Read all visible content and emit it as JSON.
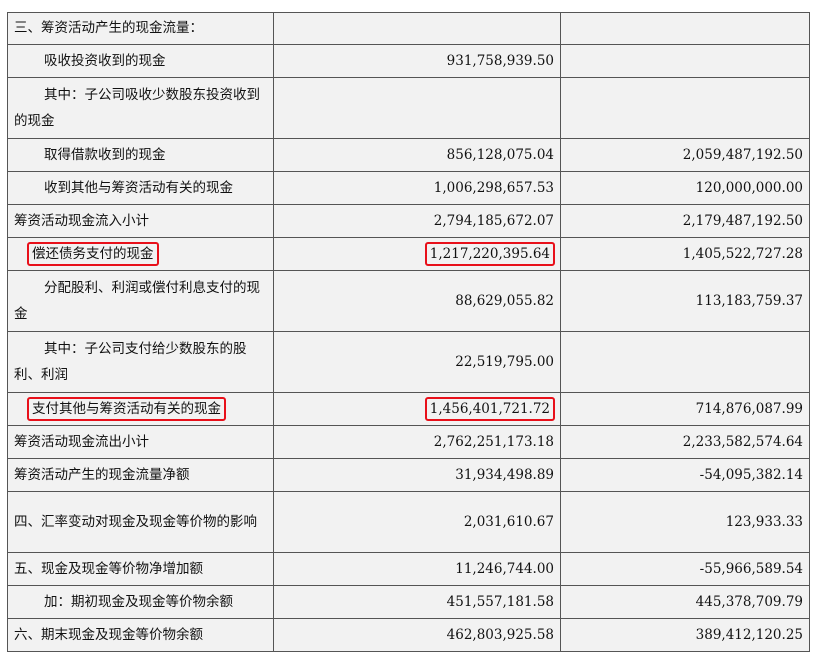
{
  "rows": [
    {
      "label": "三、筹资活动产生的现金流量：",
      "v1": "",
      "v2": ""
    },
    {
      "label": "吸收投资收到的现金",
      "v1": "931,758,939.50",
      "v2": ""
    },
    {
      "label": "其中：子公司吸收少数股东投资收到的现金",
      "v1": "",
      "v2": ""
    },
    {
      "label": "取得借款收到的现金",
      "v1": "856,128,075.04",
      "v2": "2,059,487,192.50"
    },
    {
      "label": "收到其他与筹资活动有关的现金",
      "v1": "1,006,298,657.53",
      "v2": "120,000,000.00"
    },
    {
      "label": "筹资活动现金流入小计",
      "v1": "2,794,185,672.07",
      "v2": "2,179,487,192.50"
    },
    {
      "label": "偿还债务支付的现金",
      "v1": "1,217,220,395.64",
      "v2": "1,405,522,727.28"
    },
    {
      "label": "分配股利、利润或偿付利息支付的现金",
      "v1": "88,629,055.82",
      "v2": "113,183,759.37"
    },
    {
      "label": "其中：子公司支付给少数股东的股利、利润",
      "v1": "22,519,795.00",
      "v2": ""
    },
    {
      "label": "支付其他与筹资活动有关的现金",
      "v1": "1,456,401,721.72",
      "v2": "714,876,087.99"
    },
    {
      "label": "筹资活动现金流出小计",
      "v1": "2,762,251,173.18",
      "v2": "2,233,582,574.64"
    },
    {
      "label": "筹资活动产生的现金流量净额",
      "v1": "31,934,498.89",
      "v2": "-54,095,382.14"
    },
    {
      "label": "四、汇率变动对现金及现金等价物的影响",
      "v1": "2,031,610.67",
      "v2": "123,933.33"
    },
    {
      "label": "五、现金及现金等价物净增加额",
      "v1": "11,246,744.00",
      "v2": "-55,966,589.54"
    },
    {
      "label": "加：期初现金及现金等价物余额",
      "v1": "451,557,181.58",
      "v2": "445,378,709.79"
    },
    {
      "label": "六、期末现金及现金等价物余额",
      "v1": "462,803,925.58",
      "v2": "389,412,120.25"
    }
  ]
}
